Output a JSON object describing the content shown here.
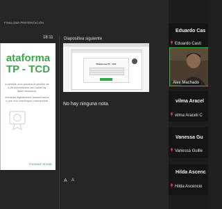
{
  "presenter": {
    "title": "FINALIZAR PRESENTACIÓN",
    "time": "18:11",
    "current_slide": {
      "title_line1": "ataforma",
      "title_line2": "TP - TCD",
      "body_lines": [
        "a permite a un usuario la gestión de",
        "s de documentos con todas las",
        "lidad necesaria.",
        "",
        "firmados digitalmente almacenados",
        "o que sus homólogos manuscritos."
      ],
      "logo_text": "THOMAS SIGNE"
    },
    "next_slide_label": "Diapositiva siguiente",
    "next_slide": {
      "dialog_title": "Plataforma TP - TCD"
    },
    "notes_text": "No hay ninguna nota.",
    "font_controls": [
      "A",
      "A"
    ]
  },
  "participants": [
    {
      "big_name": "Eduardo Cas",
      "label": "Eduardo Casti",
      "muted": true
    },
    {
      "video_label": "Alex Machado",
      "active_speaker": true
    },
    {
      "big_name": "vilma Aracel",
      "label": "vilma Araceli C",
      "muted": true
    },
    {
      "big_name": "Vanessa Gu",
      "label": "Vanessa Guille",
      "muted": true
    },
    {
      "big_name": "Hilda Ascenc",
      "label": "Hilda Ascencio",
      "muted": true
    }
  ],
  "colors": {
    "accent_green": "#39b54a",
    "mute_red": "#e23b3b"
  },
  "icons": {
    "mute": "mic-muted-icon"
  }
}
